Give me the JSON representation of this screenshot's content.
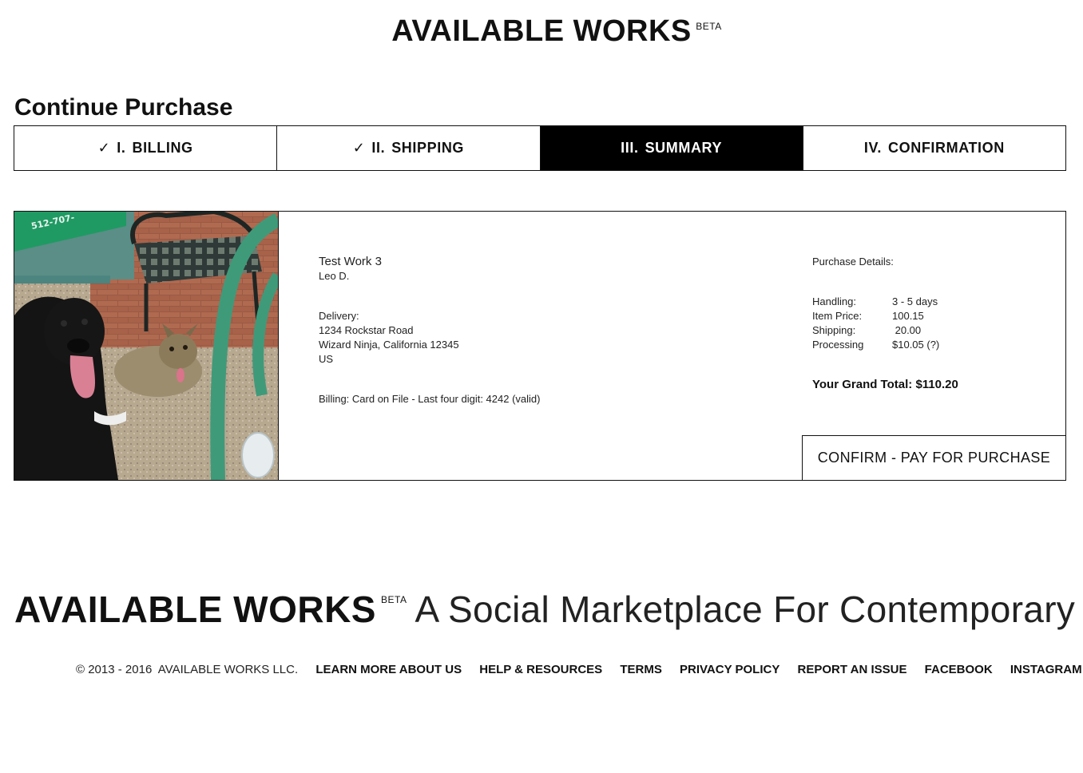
{
  "header": {
    "brand": "AVAILABLE WORKS",
    "beta": "BETA"
  },
  "page_title": "Continue Purchase",
  "steps": [
    {
      "check": "✓",
      "num": "I.",
      "label": "BILLING",
      "active": false
    },
    {
      "check": "✓",
      "num": "II.",
      "label": "SHIPPING",
      "active": false
    },
    {
      "check": "",
      "num": "III.",
      "label": "SUMMARY",
      "active": true
    },
    {
      "check": "",
      "num": "IV.",
      "label": "CONFIRMATION",
      "active": false
    }
  ],
  "work": {
    "title": "Test Work 3",
    "artist": "Leo D.",
    "delivery_label": "Delivery:",
    "address_line1": "1234 Rockstar Road",
    "address_line2": "Wizard Ninja, California 12345",
    "country": "US",
    "billing": "Billing: Card on File - Last four digit: 4242 (valid)"
  },
  "purchase_details": {
    "heading": "Purchase Details:",
    "rows": [
      {
        "label": "Handling:",
        "value": "3 - 5 days"
      },
      {
        "label": "Item Price:",
        "value": "100.15"
      },
      {
        "label": "Shipping:",
        "value": " 20.00"
      },
      {
        "label": "Processing",
        "value": "$10.05 (?)"
      }
    ],
    "grand_total": "Your Grand Total: $110.20"
  },
  "confirm_button": "CONFIRM - PAY FOR PURCHASE",
  "footer": {
    "brand": "AVAILABLE WORKS",
    "beta": "BETA",
    "tagline": "A Social Marketplace For Contemporary Art",
    "copyright": "© 2013 - 2016  AVAILABLE WORKS LLC.",
    "links": [
      "LEARN MORE ABOUT US",
      "HELP & RESOURCES",
      "TERMS",
      "PRIVACY POLICY",
      "REPORT AN ISSUE",
      "FACEBOOK",
      "INSTAGRAM"
    ]
  },
  "image_sign_text": "512-707-"
}
